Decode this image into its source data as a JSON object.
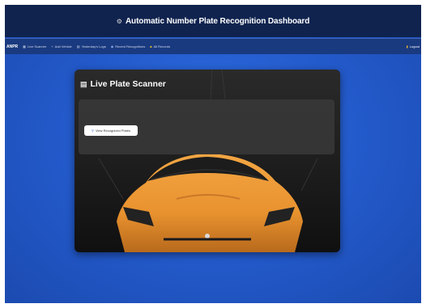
{
  "header": {
    "icon": "gear-icon",
    "title": "Automatic Number Plate Recognition Dashboard"
  },
  "nav": {
    "brand": "ANPR",
    "items": [
      {
        "label": "Live Scanner",
        "icon": "scanner-icon"
      },
      {
        "label": "Add Vehicle",
        "icon": "plus-icon"
      },
      {
        "label": "Yesterday's Logs",
        "icon": "calendar-icon"
      },
      {
        "label": "Recent Recognitions",
        "icon": "clock-icon"
      },
      {
        "label": "All Records",
        "icon": "folder-icon"
      }
    ],
    "logout": {
      "label": "Logout",
      "icon": "logout-icon"
    }
  },
  "scanner": {
    "icon": "video-icon",
    "title": "Live Plate Scanner",
    "view_button": {
      "label": "View Recognized Plates",
      "icon": "magnifier-icon"
    }
  },
  "colors": {
    "background": "#2258c8",
    "header": "#10234f",
    "navbar": "#1a3a80",
    "car": "#e8922f"
  }
}
